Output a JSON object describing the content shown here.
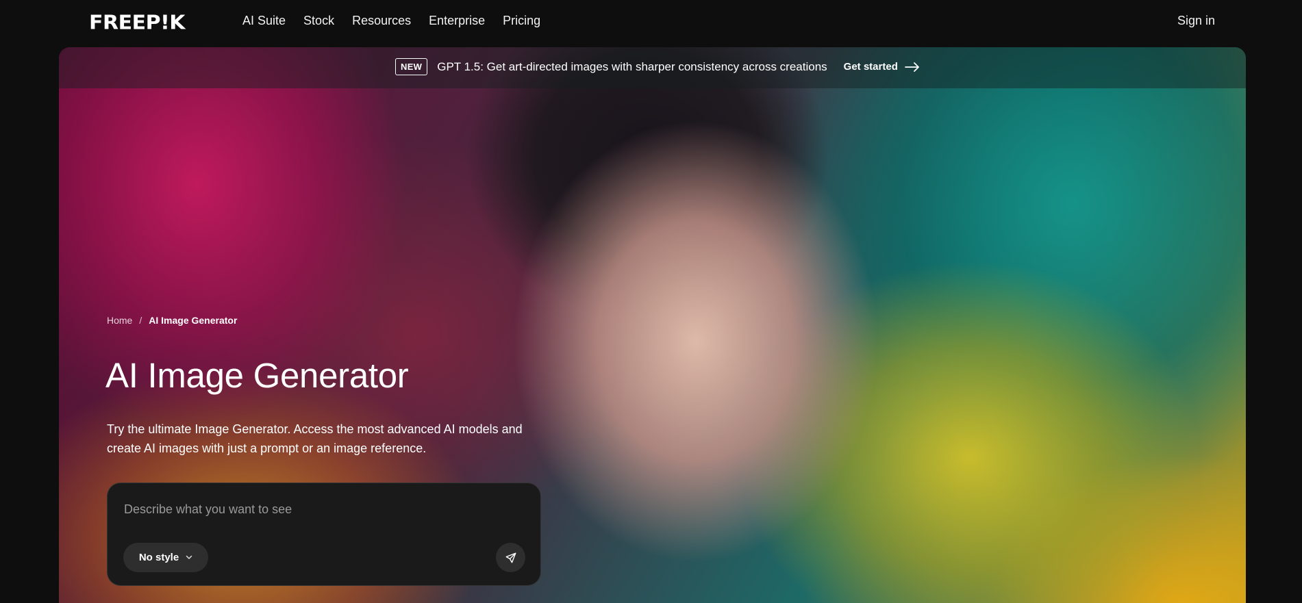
{
  "brand": {
    "logo_text": "FREEP!K"
  },
  "nav": {
    "items": [
      {
        "label": "AI Suite"
      },
      {
        "label": "Stock"
      },
      {
        "label": "Resources"
      },
      {
        "label": "Enterprise"
      },
      {
        "label": "Pricing"
      }
    ],
    "sign_in": "Sign in"
  },
  "announcement": {
    "badge": "NEW",
    "text": "GPT 1.5: Get art-directed images with sharper consistency across creations",
    "cta": "Get started",
    "cta_icon": "arrow-right-icon"
  },
  "breadcrumb": {
    "home": "Home",
    "separator": "/",
    "current": "AI Image Generator"
  },
  "hero": {
    "title": "AI Image Generator",
    "description": "Try the ultimate Image Generator. Access the most advanced AI models and create AI images with just a prompt or an image reference."
  },
  "prompt": {
    "placeholder": "Describe what you want to see",
    "value": "",
    "style_label": "No style",
    "style_icon": "chevron-down-icon",
    "send_icon": "send-icon"
  },
  "colors": {
    "page_bg": "#0e0e0e",
    "prompt_bg": "#1a1a1a",
    "button_bg": "#2e2e2e"
  }
}
